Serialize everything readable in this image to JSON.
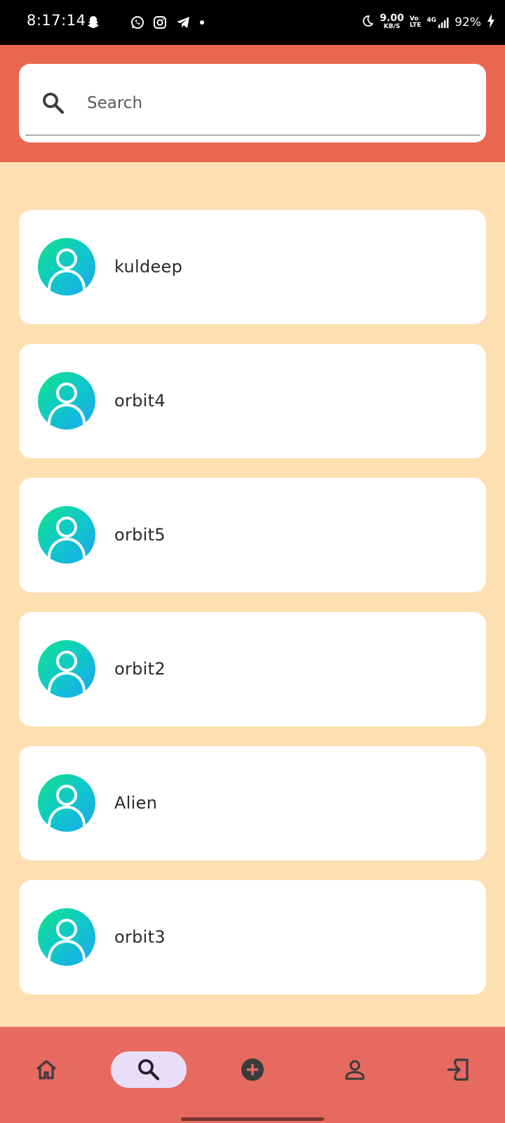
{
  "status_bar": {
    "time": "8:17:14",
    "speed_value": "9.00",
    "speed_unit": "KB/S",
    "volte_top": "Vo",
    "volte_bottom": "LTE",
    "network": "4G",
    "battery": "92%"
  },
  "search": {
    "placeholder": "Search",
    "value": ""
  },
  "users": [
    {
      "name": "kuldeep"
    },
    {
      "name": "orbit4"
    },
    {
      "name": "orbit5"
    },
    {
      "name": "orbit2"
    },
    {
      "name": "Alien"
    },
    {
      "name": "orbit3"
    }
  ],
  "bottom_nav": {
    "items": [
      {
        "icon": "home-icon",
        "active": false
      },
      {
        "icon": "search-icon",
        "active": true
      },
      {
        "icon": "add-circle-icon",
        "active": false
      },
      {
        "icon": "person-icon",
        "active": false
      },
      {
        "icon": "logout-icon",
        "active": false
      }
    ]
  },
  "colors": {
    "header": "#E9674F",
    "background": "#FDDFB2",
    "bottom_nav": "#E76A61",
    "active_pill": "#E8DEF8"
  }
}
